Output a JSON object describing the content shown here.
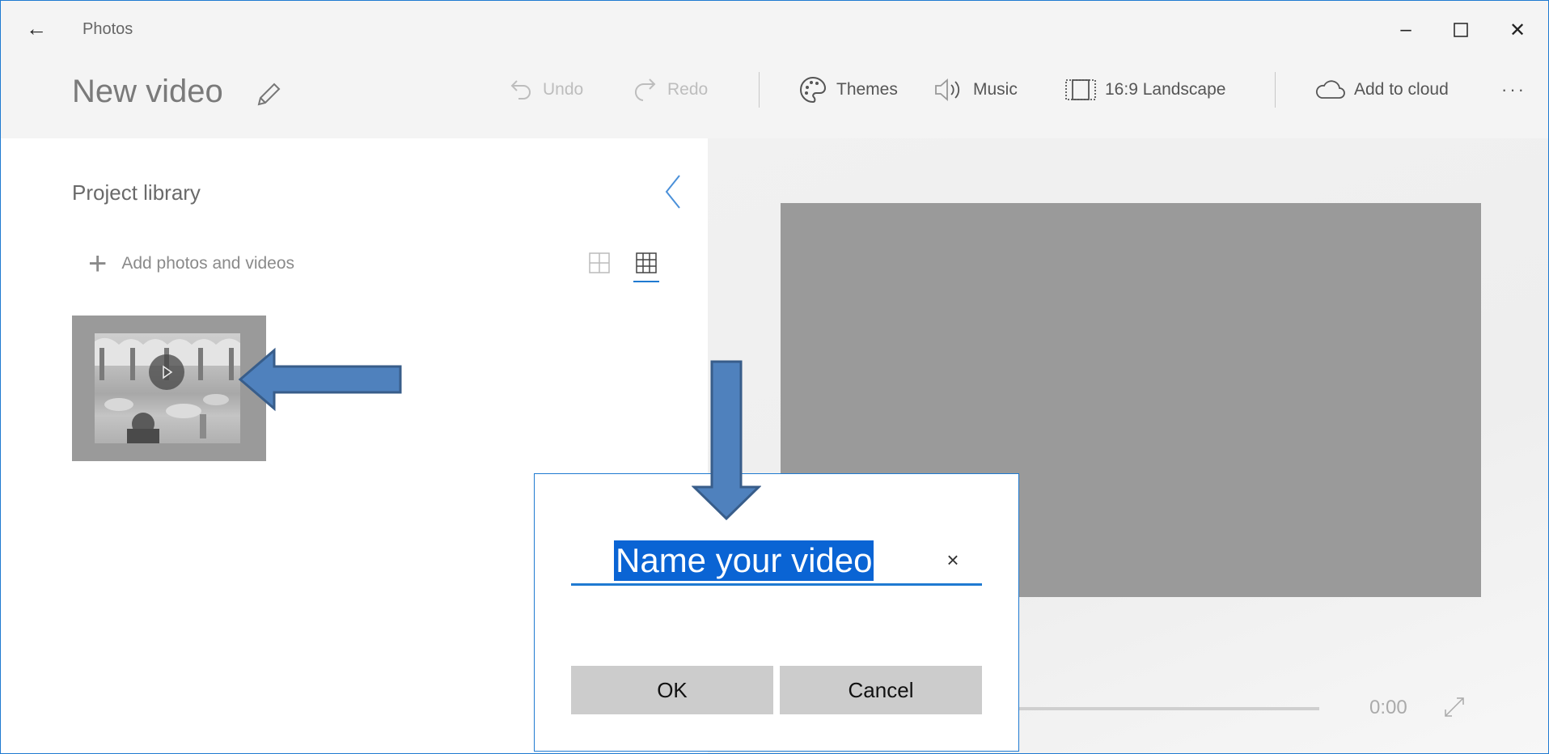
{
  "window": {
    "app_title": "Photos",
    "back_label": "←",
    "minimize_label": "–",
    "maximize_label": "☐",
    "close_label": "✕"
  },
  "header": {
    "project_name": "New video"
  },
  "toolbar": {
    "undo": "Undo",
    "redo": "Redo",
    "themes": "Themes",
    "music": "Music",
    "aspect": "16:9 Landscape",
    "cloud": "Add to cloud",
    "more": "···"
  },
  "library": {
    "title": "Project library",
    "add_label": "Add photos and videos",
    "plus": "+"
  },
  "preview": {
    "time": "0:00"
  },
  "dialog": {
    "name_value": "Name your video",
    "clear": "×",
    "ok": "OK",
    "cancel": "Cancel"
  },
  "colors": {
    "accent": "#1f7ad1",
    "selection": "#0a64d4",
    "annotation_arrow": "#4f81bd",
    "annotation_arrow_border": "#385d8a"
  },
  "icons": [
    "back-arrow-icon",
    "pencil-icon",
    "undo-icon",
    "redo-icon",
    "palette-icon",
    "speaker-icon",
    "aspect-ratio-icon",
    "cloud-icon",
    "chevron-left-icon",
    "large-grid-icon",
    "small-grid-icon",
    "play-icon",
    "fullscreen-icon",
    "close-icon"
  ]
}
